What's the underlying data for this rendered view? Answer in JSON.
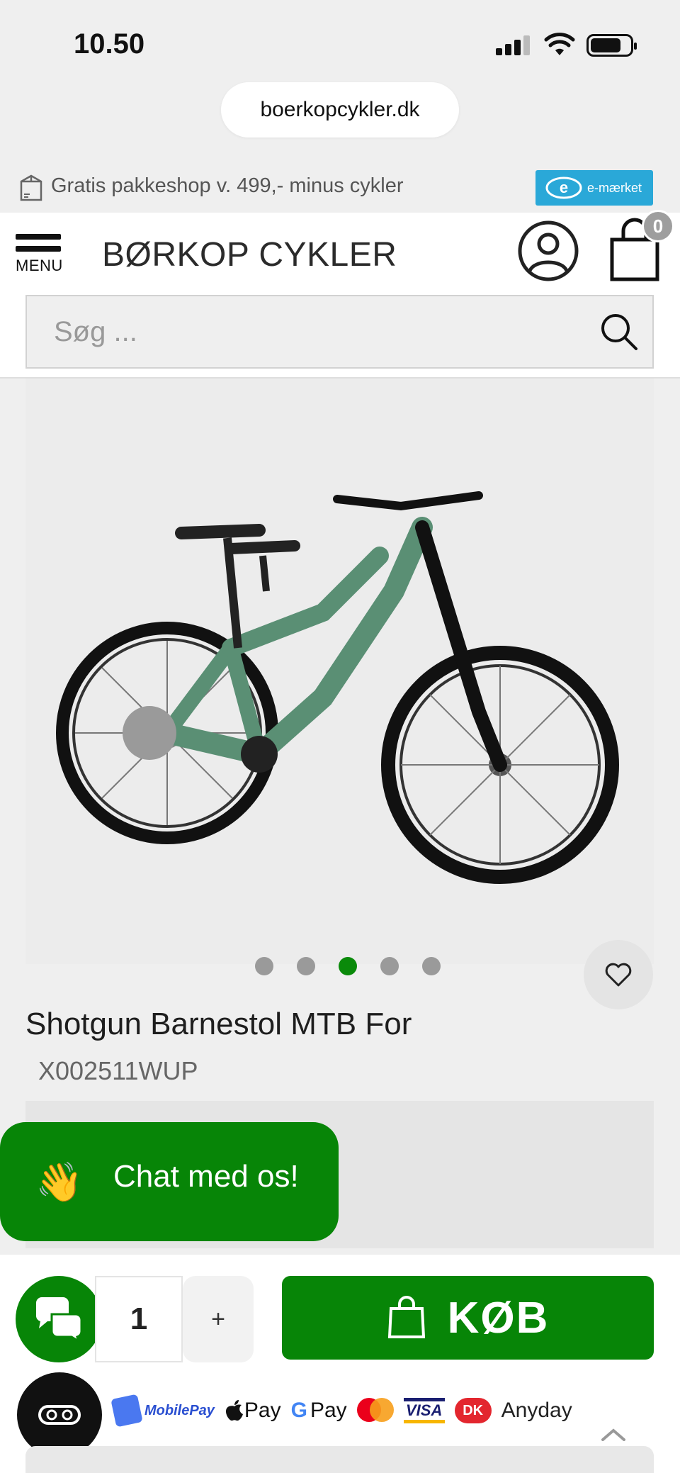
{
  "status_bar": {
    "time": "10.50"
  },
  "browser": {
    "url": "boerkopcykler.dk"
  },
  "promo": {
    "text": "Gratis pakkeshop v. 499,- minus cykler",
    "badge": "e-mærket"
  },
  "header": {
    "menu_label": "MENU",
    "logo": "BØRKOP CYKLER",
    "cart_count": "0"
  },
  "search": {
    "placeholder": "Søg ..."
  },
  "gallery": {
    "slide_count": 5,
    "active_slide": 3
  },
  "product": {
    "title": "Shotgun Barnestol MTB For",
    "sku": "X002511WUP"
  },
  "chat": {
    "wave": "👋",
    "label": "Chat med os!"
  },
  "purchase": {
    "quantity": "1",
    "plus_label": "+",
    "buy_label": "KØB"
  },
  "payment_methods": {
    "mobilepay": "MobilePay",
    "applepay": "Pay",
    "googlepay": "Pay",
    "visa": "VISA",
    "dankort": "DK",
    "anyday": "Anyday"
  },
  "colors": {
    "accent_green": "#078507",
    "emark_blue": "#2aa8d8"
  }
}
